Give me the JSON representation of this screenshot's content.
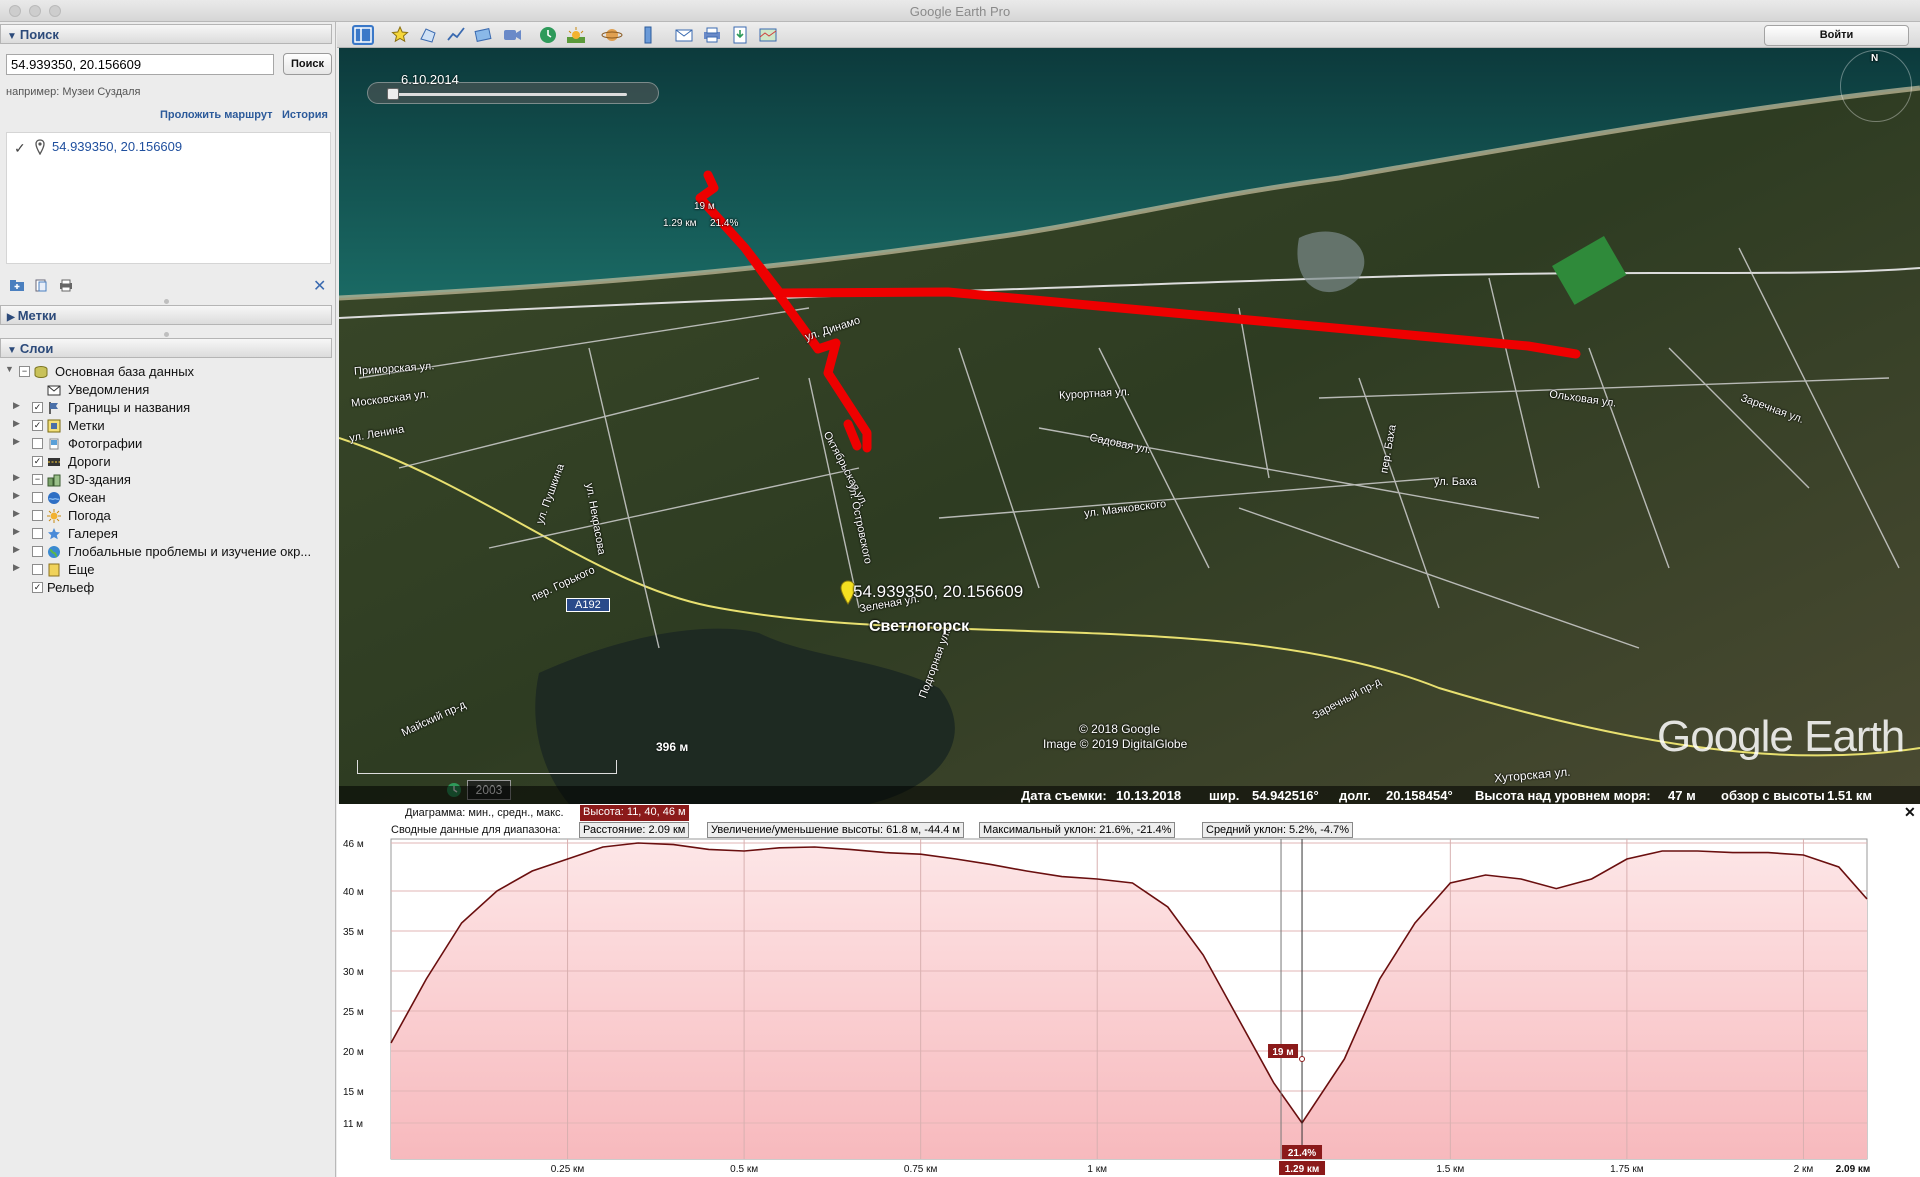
{
  "window": {
    "title": "Google Earth Pro"
  },
  "search": {
    "header": "Поиск",
    "input_value": "54.939350, 20.156609",
    "button_label": "Поиск",
    "hint": "например: Музеи Суздаля",
    "route_link": "Проложить маршрут",
    "history_link": "История",
    "result_text": "54.939350, 20.156609"
  },
  "places": {
    "header": "Метки"
  },
  "layers": {
    "header": "Слои",
    "items": [
      {
        "label": "Основная база данных",
        "icon": "database-icon"
      },
      {
        "label": "Уведомления",
        "icon": "envelope-icon"
      },
      {
        "label": "Границы и названия",
        "icon": "flag-icon"
      },
      {
        "label": "Метки",
        "icon": "places-icon"
      },
      {
        "label": "Фотографии",
        "icon": "photo-icon"
      },
      {
        "label": "Дороги",
        "icon": "road-icon"
      },
      {
        "label": "3D-здания",
        "icon": "buildings-icon"
      },
      {
        "label": "Океан",
        "icon": "ocean-icon"
      },
      {
        "label": "Погода",
        "icon": "weather-icon"
      },
      {
        "label": "Галерея",
        "icon": "gallery-icon"
      },
      {
        "label": "Глобальные проблемы и изучение окр...",
        "icon": "globe-icon"
      },
      {
        "label": "Еще",
        "icon": "more-icon"
      },
      {
        "label": "Рельеф",
        "icon": "terrain-icon"
      }
    ]
  },
  "toolbar": {
    "login_label": "Войти"
  },
  "map": {
    "time_date": "6.10.2014",
    "point_label": "54.939350, 20.156609",
    "town_label": "Светлогорск",
    "road_label": "A192",
    "copyright_1": "© 2018 Google",
    "copyright_2": "Image © 2019 DigitalGlobe",
    "logo_text": "Google Earth",
    "scale_text": "396 м",
    "year_badge": "2003",
    "compass_north": "N",
    "route_point_elev": "19 м",
    "route_point_dist": "1.29 км",
    "route_point_grade": "21.4%",
    "streets": [
      "Приморская ул.",
      "Московская ул.",
      "ул. Ленина",
      "ул. Пушкина",
      "ул. Некрасова",
      "пер. Горького",
      "Майский пр-д",
      "ул. Динамо",
      "Курортная ул.",
      "Октябрьская ул.",
      "ул. Островского",
      "ул. Маяковского",
      "Садовая ул.",
      "Зеленая ул.",
      "Подгорная ул.",
      "ул. Баха",
      "пер. Баха",
      "Ольховая ул.",
      "Заречная ул.",
      "Заречный пр-д",
      "Хуторская ул."
    ],
    "status": {
      "capture_date_label": "Дата съемки:",
      "capture_date": "10.13.2018",
      "lat_label": "шир.",
      "lat": "54.942516°",
      "lon_label": "долг.",
      "lon": "20.158454°",
      "alt_label": "Высота над уровнем моря:",
      "alt": "47 м",
      "eye_label": "обзор с высоты",
      "eye": "1.51 км"
    }
  },
  "profile": {
    "row1_label": "Диаграмма: мин., средн., макс.",
    "row1_value": "Высота: 11, 40, 46 м",
    "row2_label": "Сводные данные для диапазона:",
    "row2_distance": "Расстояние: 2.09 км",
    "row2_gain": "Увеличение/уменьшение высоты: 61.8 м, -44.4 м",
    "row2_max_slope": "Максимальный уклон: 21.6%, -21.4%",
    "row2_avg_slope": "Средний уклон: 5.2%, -4.7%",
    "cursor_elev": "19 м",
    "cursor_grade": "21.4%",
    "cursor_dist": "1.29 км",
    "end_dist": "2.09 км",
    "colors": {
      "fill": "#f7b9bd",
      "line": "#6a0f0f",
      "accent": "#8b1a1a"
    }
  },
  "chart_data": {
    "type": "area",
    "title": "",
    "xlabel": "",
    "ylabel": "",
    "x_unit": "км",
    "y_unit": "м",
    "xlim": [
      0,
      2.09
    ],
    "ylim": [
      6.5,
      46.5
    ],
    "x_ticks": [
      "0.25 км",
      "0.5 км",
      "0.75 км",
      "1 км",
      "1.29 км",
      "1.5 км",
      "1.75 км",
      "2 км",
      "2.09 км"
    ],
    "x_tick_values": [
      0.25,
      0.5,
      0.75,
      1.0,
      1.29,
      1.5,
      1.75,
      2.0,
      2.09
    ],
    "y_ticks": [
      "46 м",
      "40 м",
      "35 м",
      "30 м",
      "25 м",
      "20 м",
      "15 м",
      "11 м"
    ],
    "y_tick_values": [
      46,
      40,
      35,
      30,
      25,
      20,
      15,
      11
    ],
    "grid": true,
    "series": [
      {
        "x": [
          0,
          0.05,
          0.1,
          0.15,
          0.2,
          0.25,
          0.3,
          0.35,
          0.4,
          0.45,
          0.5,
          0.55,
          0.6,
          0.65,
          0.7,
          0.75,
          0.8,
          0.85,
          0.9,
          0.95,
          1.0,
          1.05,
          1.1,
          1.15,
          1.2,
          1.25,
          1.29,
          1.35,
          1.4,
          1.45,
          1.5,
          1.55,
          1.6,
          1.65,
          1.7,
          1.75,
          1.8,
          1.85,
          1.9,
          1.95,
          2.0,
          2.05,
          2.09
        ],
        "y": [
          21,
          29,
          36,
          40,
          42.5,
          44,
          45.5,
          46,
          45.8,
          45.2,
          45,
          45.4,
          45.5,
          45.2,
          44.8,
          44.6,
          44,
          43.3,
          42.5,
          41.8,
          41.5,
          41,
          38,
          32,
          24,
          16,
          11,
          19,
          29,
          36,
          41,
          42,
          41.5,
          40.3,
          41.5,
          44,
          45,
          45,
          44.8,
          44.8,
          44.5,
          43,
          39
        ]
      }
    ],
    "cursor": {
      "x": 1.29,
      "y": 19,
      "grade": "21.4%"
    }
  }
}
